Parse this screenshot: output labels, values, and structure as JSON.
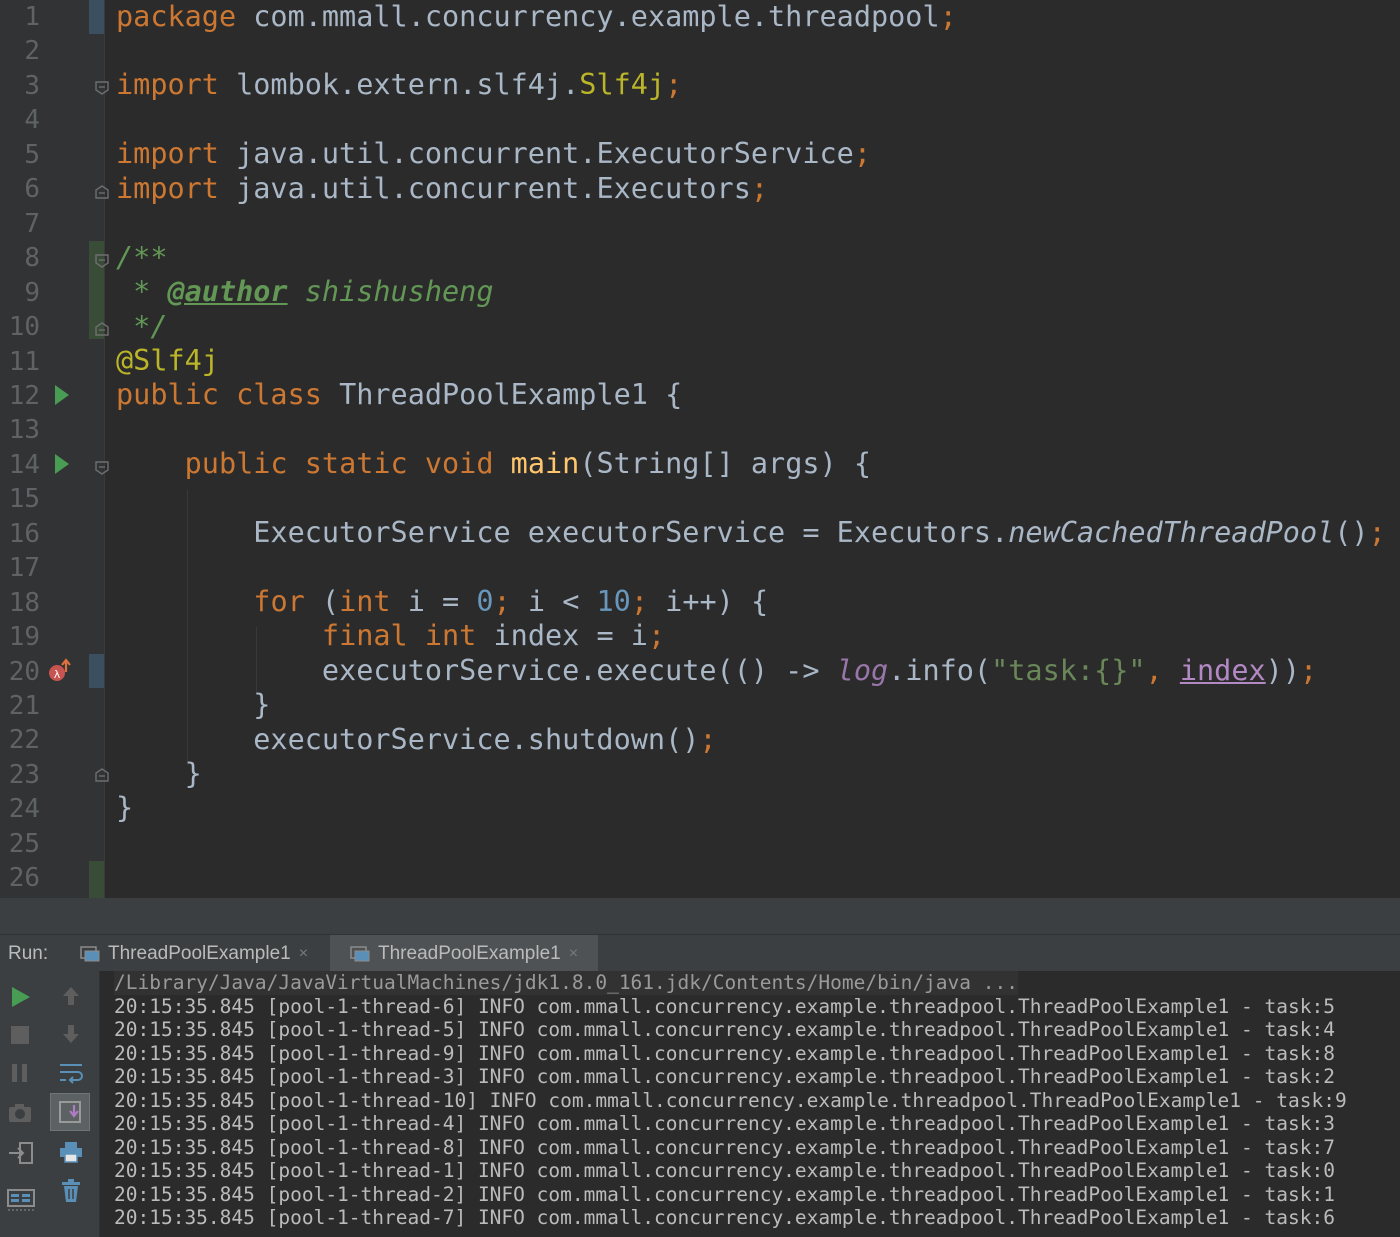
{
  "editor": {
    "line_numbers": [
      "1",
      "2",
      "3",
      "4",
      "5",
      "6",
      "7",
      "8",
      "9",
      "10",
      "11",
      "12",
      "13",
      "14",
      "15",
      "16",
      "17",
      "18",
      "19",
      "20",
      "21",
      "22",
      "23",
      "24",
      "25",
      "26"
    ],
    "code": {
      "l1_kw": "package",
      "l1_rest": " com.mmall.concurrency.example.threadpool",
      "l1_semi": ";",
      "l3_kw": "import",
      "l3_rest": " lombok.extern.slf4j.",
      "l3_cls": "Slf4j",
      "l3_semi": ";",
      "l5_kw": "import",
      "l5_rest": " java.util.concurrent.ExecutorService",
      "l5_semi": ";",
      "l6_kw": "import",
      "l6_rest": " java.util.concurrent.Executors",
      "l6_semi": ";",
      "l8": "/**",
      "l9_star": " * ",
      "l9_tag": "@author",
      "l9_name": " shishusheng",
      "l10": " */",
      "l11": "@Slf4j",
      "l12_kw": "public class",
      "l12_rest": " ThreadPoolExample1 {",
      "l14_indent": "    ",
      "l14_kw": "public static void",
      "l14_sp": " ",
      "l14_fn": "main",
      "l14_rest": "(String[] args) {",
      "l16_text": "        ExecutorService executorService = Executors.",
      "l16_ital": "newCachedThreadPool",
      "l16_paren": "()",
      "l16_semi": ";",
      "l18_indent": "        ",
      "l18_for": "for",
      "l18_p1": " (",
      "l18_int": "int",
      "l18_p2": " i = ",
      "l18_zero": "0",
      "l18_semi1": ";",
      "l18_p3": " i < ",
      "l18_ten": "10",
      "l18_semi2": ";",
      "l18_p4": " i++) {",
      "l19_indent": "            ",
      "l19_kw": "final int",
      "l19_rest": " index = i",
      "l19_semi": ";",
      "l20_text": "            executorService.execute(() -> ",
      "l20_log": "log",
      "l20_info": ".info(",
      "l20_str": "\"task:{}\"",
      "l20_comma": ", ",
      "l20_idx": "index",
      "l20_close": "))",
      "l20_semi": ";",
      "l21": "        }",
      "l22_text": "        executorService.shutdown()",
      "l22_semi": ";",
      "l23": "    }",
      "l24": "}"
    }
  },
  "run_panel": {
    "label": "Run:",
    "tabs": [
      {
        "label": "ThreadPoolExample1",
        "close": "×"
      },
      {
        "label": "ThreadPoolExample1",
        "close": "×"
      }
    ],
    "console": {
      "command": "/Library/Java/JavaVirtualMachines/jdk1.8.0_161.jdk/Contents/Home/bin/java ...",
      "lines": [
        "20:15:35.845 [pool-1-thread-6] INFO com.mmall.concurrency.example.threadpool.ThreadPoolExample1 - task:5",
        "20:15:35.845 [pool-1-thread-5] INFO com.mmall.concurrency.example.threadpool.ThreadPoolExample1 - task:4",
        "20:15:35.845 [pool-1-thread-9] INFO com.mmall.concurrency.example.threadpool.ThreadPoolExample1 - task:8",
        "20:15:35.845 [pool-1-thread-3] INFO com.mmall.concurrency.example.threadpool.ThreadPoolExample1 - task:2",
        "20:15:35.845 [pool-1-thread-10] INFO com.mmall.concurrency.example.threadpool.ThreadPoolExample1 - task:9",
        "20:15:35.845 [pool-1-thread-4] INFO com.mmall.concurrency.example.threadpool.ThreadPoolExample1 - task:3",
        "20:15:35.845 [pool-1-thread-8] INFO com.mmall.concurrency.example.threadpool.ThreadPoolExample1 - task:7",
        "20:15:35.845 [pool-1-thread-1] INFO com.mmall.concurrency.example.threadpool.ThreadPoolExample1 - task:0",
        "20:15:35.845 [pool-1-thread-2] INFO com.mmall.concurrency.example.threadpool.ThreadPoolExample1 - task:1",
        "20:15:35.845 [pool-1-thread-7] INFO com.mmall.concurrency.example.threadpool.ThreadPoolExample1 - task:6"
      ]
    }
  },
  "icons": {
    "run_gutter": "run-arrow-icon",
    "breakpoint": "lambda-breakpoint-icon",
    "toolbar": [
      "rerun-icon",
      "stop-icon",
      "pause-icon",
      "camera-icon",
      "exit-icon",
      "layout-icon",
      "up-arrow-icon",
      "down-arrow-icon",
      "soft-wrap-icon",
      "scroll-to-end-icon",
      "print-icon",
      "trash-icon"
    ]
  },
  "colors": {
    "background": "#2b2b2b",
    "keyword": "#cc7832",
    "string": "#6a8759",
    "number": "#6897bb",
    "annotation": "#bbb529",
    "doc": "#629755",
    "run_green": "#499c54"
  }
}
